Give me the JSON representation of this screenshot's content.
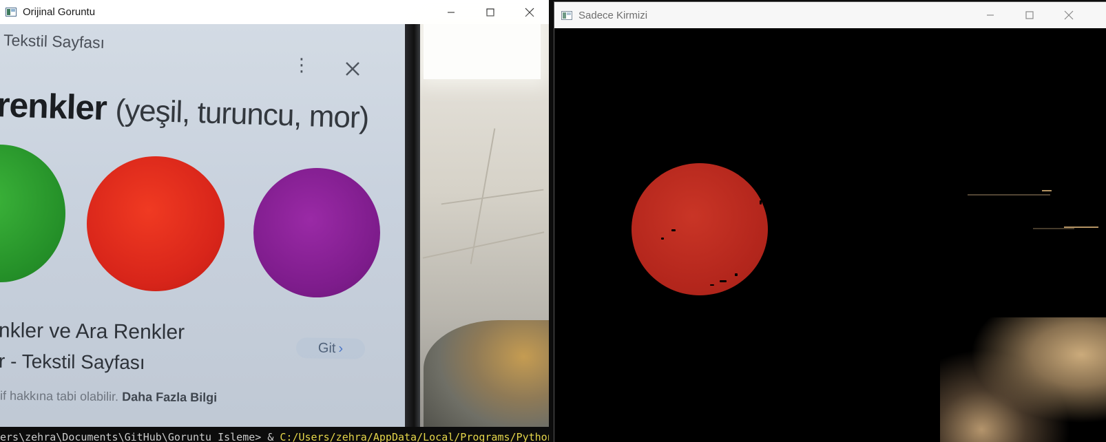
{
  "windows": {
    "original": {
      "title": "Orijinal Goruntu",
      "camera_frame": {
        "page_title": "Tekstil Sayfası",
        "headline_bold": "renkler",
        "headline_rest": "(yeşil, turuncu, mor)",
        "subheading_1": "nkler ve Ara Renkler",
        "subheading_2": "r - Tekstil Sayfası",
        "go_button_label": "Git",
        "go_button_chevron": "›",
        "footnote_text": "if hakkına tabi olabilir.",
        "footnote_link": "Daha Fazla Bilgi",
        "disc_colors": {
          "green": "#2a9a2c",
          "red": "#d8251a",
          "purple": "#7e1c8c"
        }
      },
      "terminal_prompt": "ers\\zehra\\Documents\\GitHub\\Goruntu_Isleme> & ",
      "terminal_path": "C:/Users/zehra/AppData/Local/Programs/Python"
    },
    "mask": {
      "title": "Sadece Kirmizi",
      "mask_color": "#b5271d"
    }
  },
  "caption_buttons": {
    "minimize": "minimize",
    "maximize": "maximize",
    "close": "close"
  }
}
